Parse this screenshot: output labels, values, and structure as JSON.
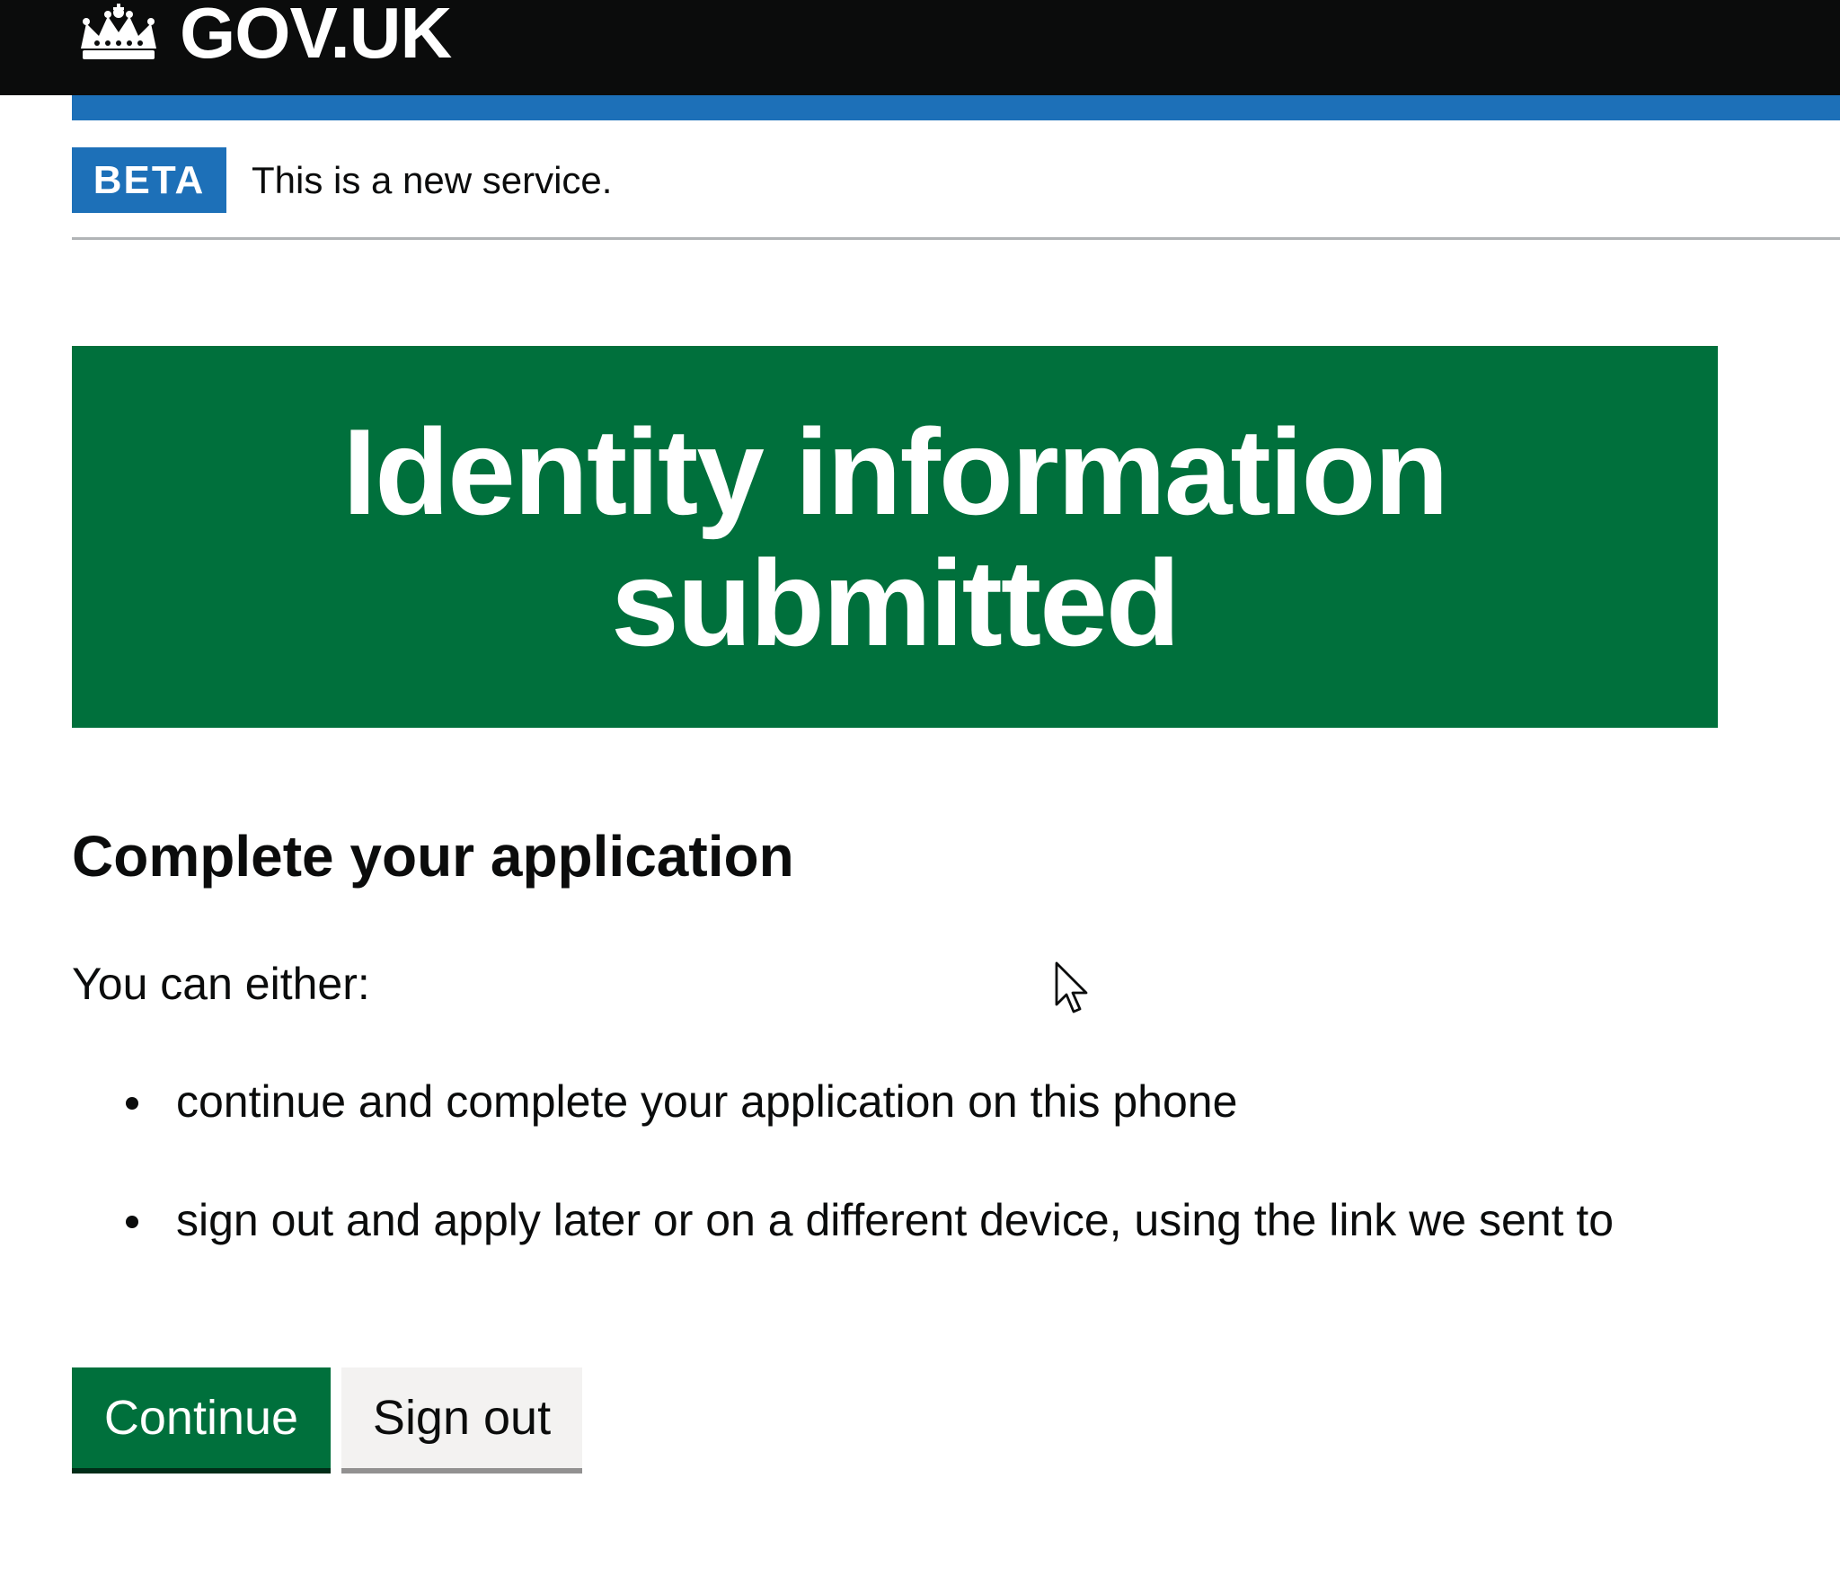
{
  "header": {
    "logo_text": "GOV.UK",
    "logo_icon": "crown-icon",
    "background_color": "#0b0c0c",
    "accent_bar_color": "#1d70b8"
  },
  "phase_banner": {
    "tag": "BETA",
    "text": "This is a new service.",
    "tag_color": "#1d70b8"
  },
  "confirmation_panel": {
    "title": "Identity information submitted",
    "background_color": "#00703c"
  },
  "main": {
    "heading": "Complete your application",
    "intro": "You can either:",
    "options": [
      "continue and complete your application on this phone",
      "sign out and apply later or on a different device, using the link we sent to"
    ]
  },
  "buttons": {
    "continue_label": "Continue",
    "sign_out_label": "Sign out",
    "primary_color": "#00703c",
    "secondary_color": "#f3f2f1"
  },
  "pointer": {
    "icon": "mouse-pointer-icon"
  }
}
